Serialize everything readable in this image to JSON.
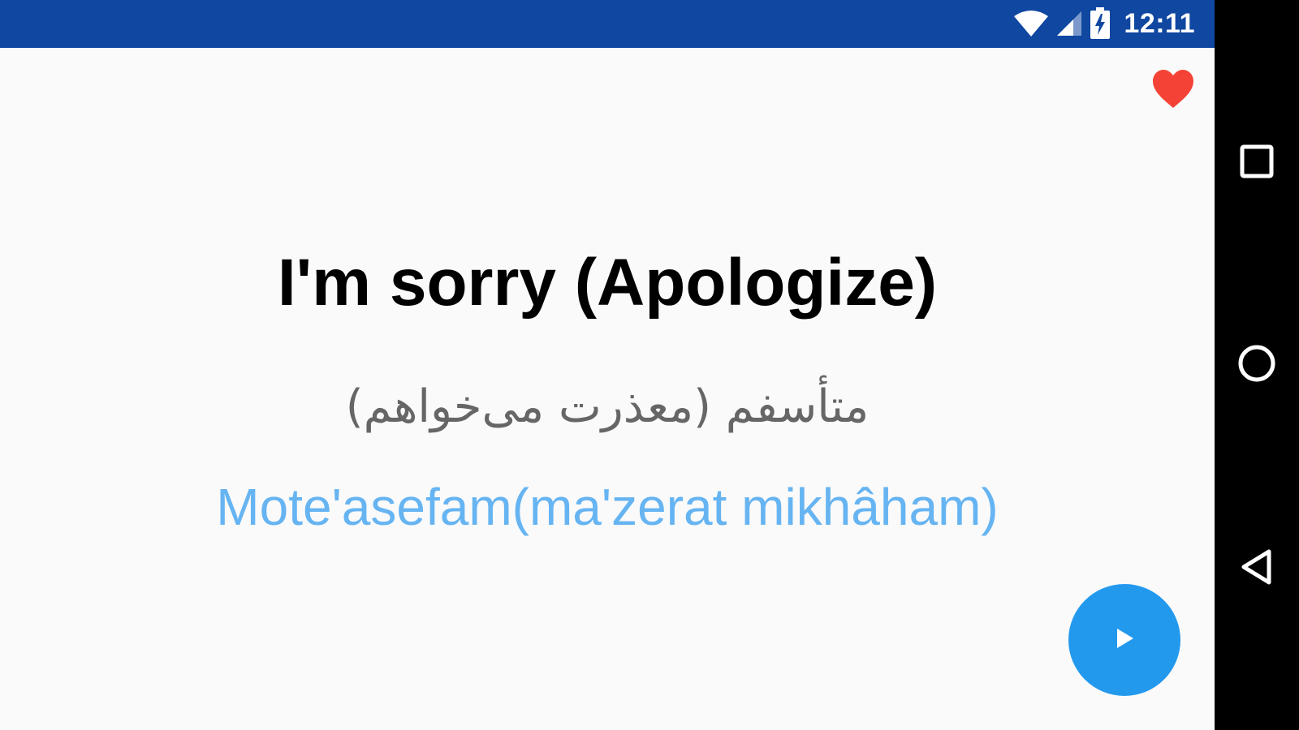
{
  "status_bar": {
    "time": "12:11",
    "icons": [
      "wifi-icon",
      "cellular-signal-icon",
      "battery-charging-icon"
    ]
  },
  "favorite": {
    "icon": "heart-icon",
    "color": "#f44336"
  },
  "phrase": {
    "english": "I'm sorry (Apologize)",
    "persian": "متأسفم (معذرت می‌خواهم)",
    "transliteration": "Mote'asefam(ma'zerat mikhâham)"
  },
  "play_button": {
    "icon": "play-icon",
    "color": "#2399ee"
  },
  "nav_bar": {
    "buttons": [
      "recents-icon",
      "home-icon",
      "back-icon"
    ]
  },
  "colors": {
    "status_bar": "#0f47a1",
    "background": "#fafafa",
    "english_text": "#000000",
    "persian_text": "#666666",
    "transliteration_text": "#66b4f2"
  }
}
